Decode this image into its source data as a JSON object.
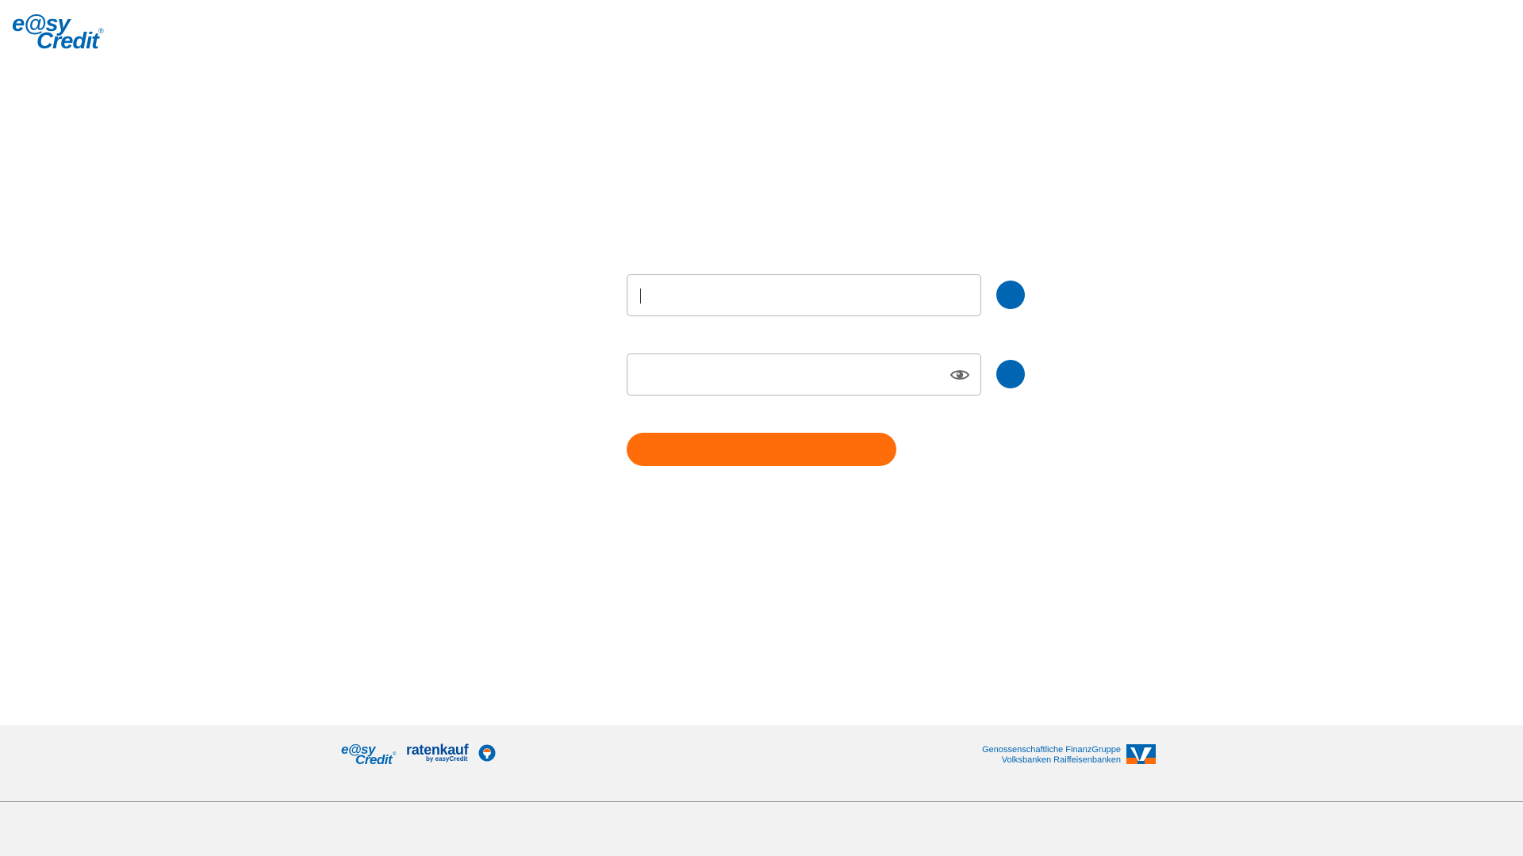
{
  "header": {
    "logo": {
      "line1": "e@sy",
      "line2": "Credit",
      "registered": "®"
    }
  },
  "form": {
    "username": {
      "value": "",
      "placeholder": "",
      "info_icon": "info-icon"
    },
    "password": {
      "value": "",
      "placeholder": "",
      "toggle_icon": "eye-icon",
      "info_icon": "info-icon"
    },
    "submit_label": ""
  },
  "footer": {
    "easycredit_logo": {
      "line1": "e@sy",
      "line2": "Credit",
      "registered": "®"
    },
    "ratenkauf_logo": {
      "main": "ratenkauf",
      "sub": "by easyCredit"
    },
    "vr_text": {
      "line1": "Genossenschaftliche FinanzGruppe",
      "line2": "Volksbanken Raiffeisenbanken"
    }
  },
  "colors": {
    "brand_blue": "#0066b3",
    "accent_orange": "#ff6c0a",
    "footer_bg": "#f2f2f2"
  }
}
